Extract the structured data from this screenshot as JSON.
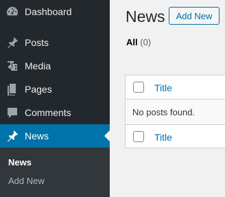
{
  "sidebar": {
    "items": [
      {
        "label": "Dashboard",
        "icon": "dashboard-icon"
      },
      {
        "label": "Posts",
        "icon": "pushpin-icon"
      },
      {
        "label": "Media",
        "icon": "media-icon"
      },
      {
        "label": "Pages",
        "icon": "pages-icon"
      },
      {
        "label": "Comments",
        "icon": "comment-icon"
      },
      {
        "label": "News",
        "icon": "pushpin-icon",
        "active": true
      }
    ],
    "submenu": [
      {
        "label": "News",
        "current": true
      },
      {
        "label": "Add New"
      }
    ]
  },
  "main": {
    "title": "News",
    "add_new_label": "Add New",
    "filter": {
      "label": "All",
      "count": "(0)"
    },
    "table": {
      "column_title": "Title",
      "empty_message": "No posts found."
    }
  },
  "colors": {
    "sidebar_bg": "#23282d",
    "active_bg": "#0073aa",
    "link": "#0073aa"
  }
}
